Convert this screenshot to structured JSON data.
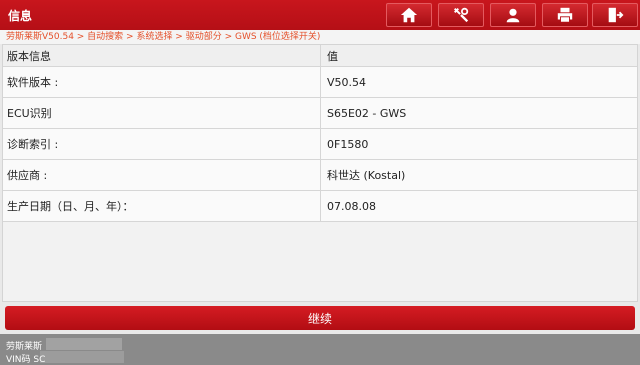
{
  "header": {
    "title": "信息",
    "buttons": [
      "home-icon",
      "diagnose-icon",
      "user-icon",
      "print-icon",
      "exit-icon"
    ]
  },
  "breadcrumb": "劳斯莱斯V50.54 > 自动搜索 > 系统选择 > 驱动部分 > GWS (档位选择开关)",
  "table": {
    "columns": [
      "版本信息",
      "值"
    ],
    "rows": [
      {
        "label": "软件版本 :",
        "value": "V50.54"
      },
      {
        "label": "ECU识别",
        "value": "S65E02 - GWS"
      },
      {
        "label": "诊断索引 :",
        "value": "0F1580"
      },
      {
        "label": "供应商 :",
        "value": "科世达 (Kostal)"
      },
      {
        "label": "生产日期（日、月、年）：",
        "value": "07.08.08"
      }
    ]
  },
  "continue_label": "继续",
  "footer": {
    "line1": "劳斯莱斯",
    "line2": "VIN码 SC"
  },
  "colors": {
    "accent": "#c8161d",
    "breadcrumb": "#e4502a"
  }
}
